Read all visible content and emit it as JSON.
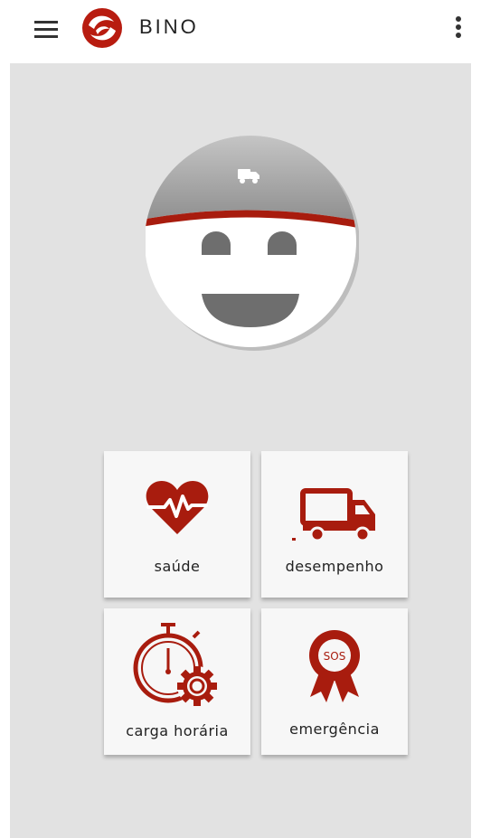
{
  "app": {
    "title": "BINO"
  },
  "colors": {
    "accent": "#a81c0e",
    "background": "#e2e2e2",
    "tile": "#f7f7f7"
  },
  "header": {
    "menu_icon": "hamburger-menu-icon",
    "logo_icon": "bino-logo-icon",
    "overflow_icon": "more-vert-icon"
  },
  "avatar": {
    "cap_icon": "truck-icon"
  },
  "tiles": [
    {
      "label": "saúde",
      "icon": "heart-pulse-icon"
    },
    {
      "label": "desempenho",
      "icon": "truck-icon"
    },
    {
      "label": "carga horária",
      "icon": "stopwatch-gear-icon"
    },
    {
      "label": "emergência",
      "icon": "sos-badge-icon",
      "badge_text": "SOS"
    }
  ]
}
